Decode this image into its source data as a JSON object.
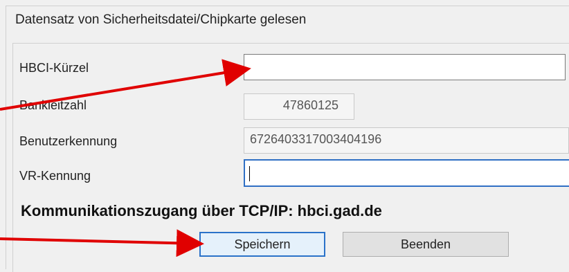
{
  "dialog": {
    "title": "Datensatz von Sicherheitsdatei/Chipkarte gelesen"
  },
  "fields": {
    "hbci_label": "HBCI-Kürzel",
    "hbci_value": "",
    "blz_label": "Bankleitzahl",
    "blz_value": "47860125",
    "user_label": "Benutzerkennung",
    "user_value": "6726403317003404196",
    "vr_label": "VR-Kennung",
    "vr_value": ""
  },
  "info": {
    "text": "Kommunikationszugang über TCP/IP: hbci.gad.de"
  },
  "buttons": {
    "save": "Speichern",
    "quit": "Beenden"
  },
  "colors": {
    "arrow": "#e00000",
    "focus": "#2a72c9"
  }
}
